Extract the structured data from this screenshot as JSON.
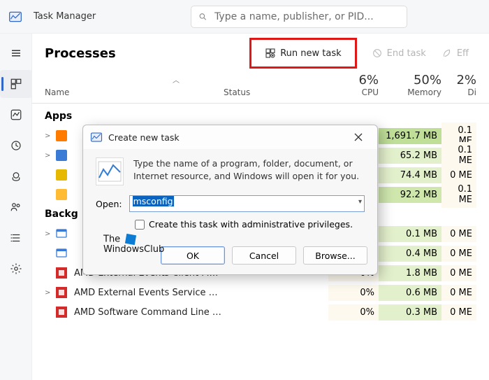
{
  "titlebar": {
    "app_name": "Task Manager"
  },
  "search": {
    "placeholder": "Type a name, publisher, or PID..."
  },
  "sidebar": {
    "items": [
      "menu",
      "processes",
      "performance",
      "history",
      "startup",
      "users",
      "details",
      "settings"
    ]
  },
  "toolbar": {
    "page_title": "Processes",
    "run_new_task": "Run new task",
    "end_task": "End task",
    "efficiency": "Eff"
  },
  "columns": {
    "name": "Name",
    "status": "Status",
    "cpu_pct": "6%",
    "cpu_label": "CPU",
    "mem_pct": "50%",
    "mem_label": "Memory",
    "disk_pct": "2%",
    "disk_label": "Di"
  },
  "groups": {
    "apps": "Apps",
    "background": "Backg"
  },
  "rows": {
    "apps": [
      {
        "expand": ">",
        "name": "",
        "cpu": "%",
        "mem": "1,691.7 MB",
        "disk": "0.1 ME",
        "cpu_hm": "hm0",
        "mem_hm": "hm3",
        "disk_hm": "hm0"
      },
      {
        "expand": ">",
        "name": "",
        "cpu": "%",
        "mem": "65.2 MB",
        "disk": "0.1 ME",
        "cpu_hm": "hm0",
        "mem_hm": "hm1",
        "disk_hm": "hm0"
      },
      {
        "expand": "",
        "name": "",
        "cpu": "%",
        "mem": "74.4 MB",
        "disk": "0 ME",
        "cpu_hm": "hm0",
        "mem_hm": "hm1",
        "disk_hm": "hm0"
      },
      {
        "expand": "",
        "name": "",
        "cpu": "",
        "mem": "92.2 MB",
        "disk": "0.1 ME",
        "cpu_hm": "",
        "mem_hm": "hm2",
        "disk_hm": "hm0"
      }
    ],
    "bg": [
      {
        "expand": ">",
        "name": "",
        "cpu": "%",
        "mem": "0.1 MB",
        "disk": "0 ME",
        "cpu_hm": "hm0",
        "mem_hm": "hm1",
        "disk_hm": "hm0"
      },
      {
        "expand": "",
        "name": "",
        "cpu": "%",
        "mem": "0.4 MB",
        "disk": "0 ME",
        "cpu_hm": "hm0",
        "mem_hm": "hm1",
        "disk_hm": "hm0"
      },
      {
        "expand": "",
        "name": "AMD External Events Client Module",
        "cpu": "0%",
        "mem": "1.8 MB",
        "disk": "0 ME",
        "cpu_hm": "hm0",
        "mem_hm": "hm1",
        "disk_hm": "hm0"
      },
      {
        "expand": ">",
        "name": "AMD External Events Service Modu...",
        "cpu": "0%",
        "mem": "0.6 MB",
        "disk": "0 ME",
        "cpu_hm": "hm0",
        "mem_hm": "hm1",
        "disk_hm": "hm0"
      },
      {
        "expand": "",
        "name": "AMD Software Command Line Inte...",
        "cpu": "0%",
        "mem": "0.3 MB",
        "disk": "0 ME",
        "cpu_hm": "hm0",
        "mem_hm": "hm1",
        "disk_hm": "hm0"
      }
    ]
  },
  "dialog": {
    "title": "Create new task",
    "desc1": "Type the name of a program, folder, document, or",
    "desc2": "Internet resource, and Windows will open it for you.",
    "open_label": "Open:",
    "input_value": "msconfig",
    "checkbox_label": "Create this task with administrative privileges.",
    "ok": "OK",
    "cancel": "Cancel",
    "browse": "Browse..."
  },
  "watermark": {
    "line1": "The",
    "line2": "WindowsClub"
  }
}
